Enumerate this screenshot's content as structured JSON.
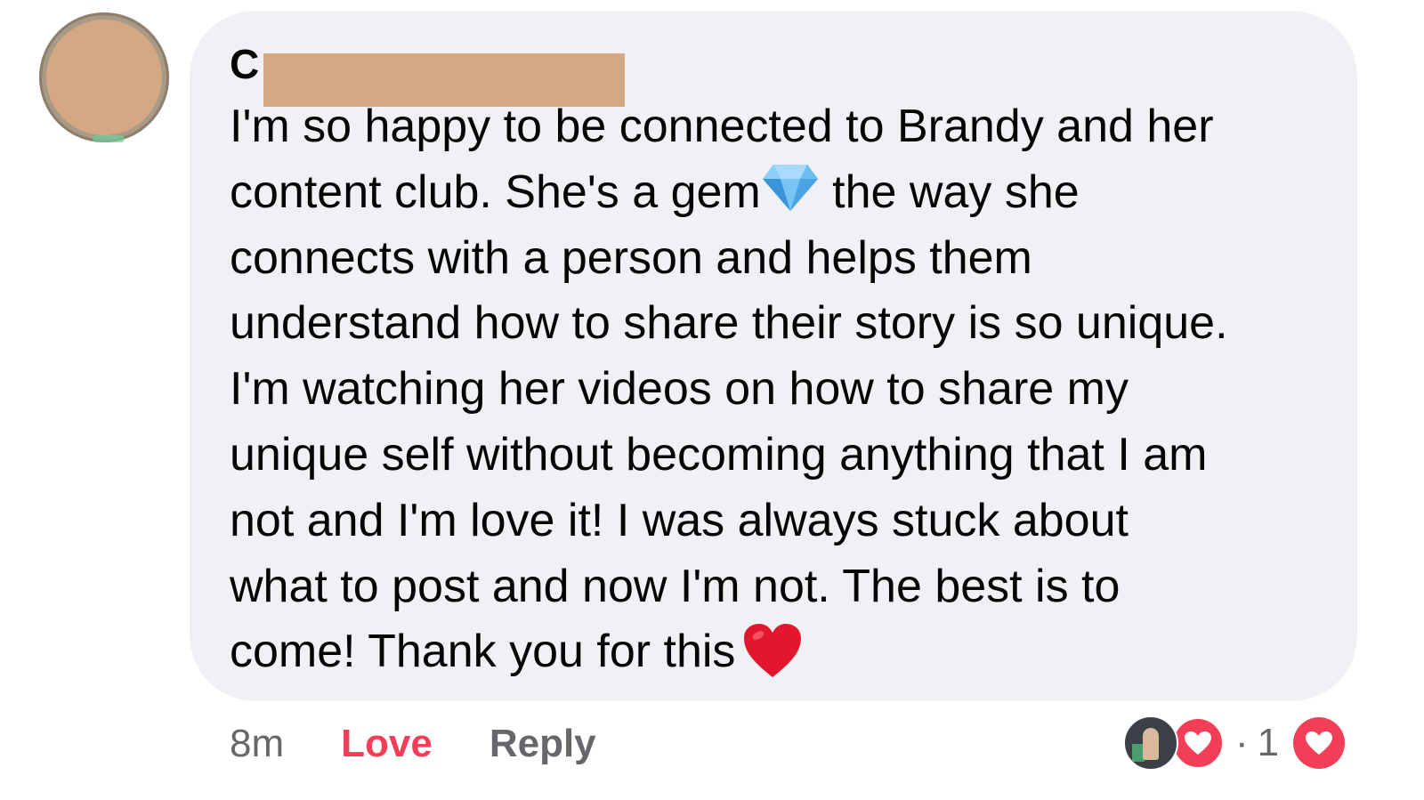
{
  "comment": {
    "author_visible": "C",
    "lines": [
      "I'm so happy to be connected to Brandy and her",
      "content club. She's a gem",
      " the way she",
      "connects with a person and helps them",
      "understand how to share their story is so unique.",
      "I'm watching her videos on how to share my",
      "unique self without becoming anything that I am",
      "not and I'm love it! I was always stuck about",
      "what to post and now I'm not. The best is to",
      "come! Thank you for this"
    ],
    "gem_emoji": "gem-icon",
    "heart_emoji": "red-heart-icon"
  },
  "actions": {
    "time": "8m",
    "love_label": "Love",
    "reply_label": "Reply"
  },
  "reactions": {
    "separator": "·",
    "count": "1"
  },
  "colors": {
    "bubble": "#f0f1f5",
    "love": "#f33e58",
    "muted": "#65676b",
    "redaction": "#d4a882"
  }
}
